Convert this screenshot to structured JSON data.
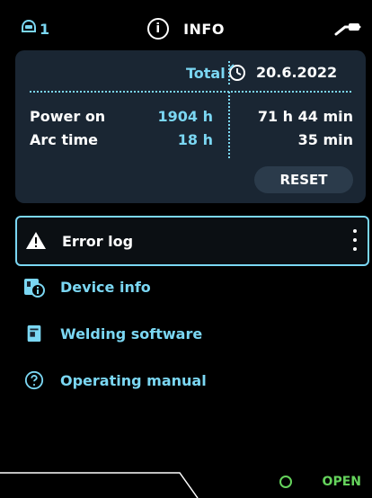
{
  "header": {
    "channel": "1",
    "title": "INFO"
  },
  "stats": {
    "total_header": "Total",
    "date_header": "20.6.2022",
    "rows": [
      {
        "label": "Power on",
        "total": "1904 h",
        "since_date": "71 h 44 min"
      },
      {
        "label": "Arc time",
        "total": "18 h",
        "since_date": "35 min"
      }
    ],
    "reset_label": "RESET"
  },
  "menu": {
    "items": [
      {
        "label": "Error log",
        "selected": true
      },
      {
        "label": "Device info"
      },
      {
        "label": "Welding software"
      },
      {
        "label": "Operating manual"
      }
    ]
  },
  "status": {
    "label": "OPEN",
    "color": "#65d35c"
  },
  "colors": {
    "accent": "#7bd7f3",
    "card_bg": "#1a2633",
    "pill_bg": "#2b3b4b"
  }
}
